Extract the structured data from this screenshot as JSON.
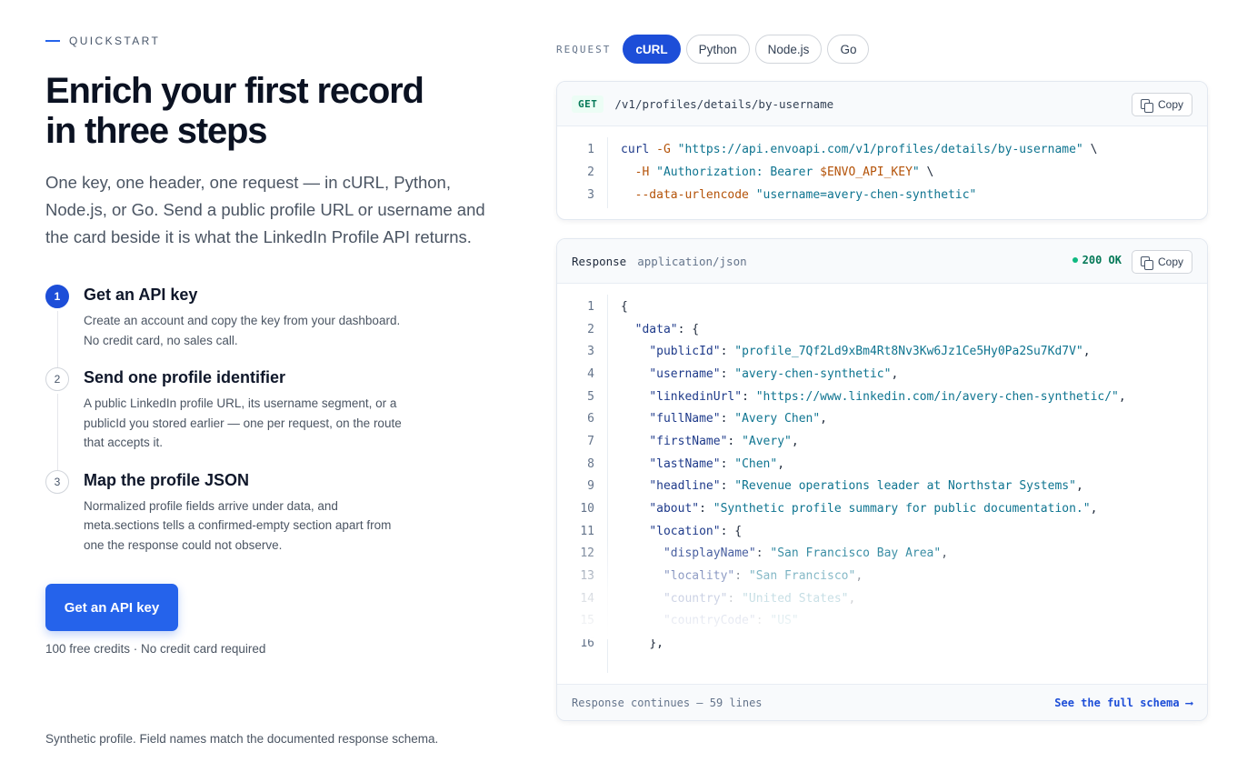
{
  "hero": {
    "eyebrow": "QUICKSTART",
    "title": "Enrich your first record in three steps",
    "lede": "One key, one header, one request — in cURL, Python, Node.js, or Go. Send a public profile URL or username and the card beside it is what the LinkedIn Profile API returns."
  },
  "steps": [
    {
      "number": "1",
      "title": "Get an API key",
      "body": "Create an account and copy the key from your dashboard. No credit card, no sales call."
    },
    {
      "number": "2",
      "title": "Send one profile identifier",
      "body": "A public LinkedIn profile URL, its username segment, or a publicId you stored earlier — one per request, on the route that accepts it."
    },
    {
      "number": "3",
      "title": "Map the profile JSON",
      "body": "Normalized profile fields arrive under data, and meta.sections tells a confirmed-empty section apart from one the response could not observe."
    }
  ],
  "cta": {
    "label": "Get an API key",
    "sub": "100 free credits · No credit card required"
  },
  "footnote": "Synthetic profile. Field names match the documented response schema.",
  "request": {
    "label": "REQUEST",
    "tabs": [
      "cURL",
      "Python",
      "Node.js",
      "Go"
    ],
    "active_tab": 0,
    "method": "GET",
    "path": "/v1/profiles/details/by-username",
    "copy_label": "Copy",
    "line_numbers": [
      "1",
      "2",
      "3"
    ],
    "line1": {
      "cmd": "curl",
      "flag": "-G",
      "url": "\"https://api.envoapi.com/v1/profiles/details/by-username\"",
      "cont": " \\"
    },
    "line2": {
      "flag": "-H",
      "header": "\"Authorization: Bearer ",
      "var": "$ENVO_API_KEY",
      "end": "\"",
      "cont": " \\"
    },
    "line3": {
      "flag": "--data-urlencode",
      "value": "\"username=avery-chen-synthetic\""
    }
  },
  "response": {
    "label": "Response",
    "content_type": "application/json",
    "status": "200 OK",
    "copy_label": "Copy",
    "line_numbers": [
      "1",
      "2",
      "3",
      "4",
      "5",
      "6",
      "7",
      "8",
      "9",
      "10",
      "11",
      "12",
      "13",
      "14",
      "15",
      "16"
    ],
    "lines": [
      {
        "indent": "",
        "key": "",
        "value": "",
        "tail": "{"
      },
      {
        "indent": "  ",
        "key": "\"data\"",
        "value": "",
        "tail": ": {"
      },
      {
        "indent": "    ",
        "key": "\"publicId\"",
        "value": "\"profile_7Qf2Ld9xBm4Rt8Nv3Kw6Jz1Ce5Hy0Pa2Su7Kd7V\"",
        "tail": ","
      },
      {
        "indent": "    ",
        "key": "\"username\"",
        "value": "\"avery-chen-synthetic\"",
        "tail": ","
      },
      {
        "indent": "    ",
        "key": "\"linkedinUrl\"",
        "value": "\"https://www.linkedin.com/in/avery-chen-synthetic/\"",
        "tail": ","
      },
      {
        "indent": "    ",
        "key": "\"fullName\"",
        "value": "\"Avery Chen\"",
        "tail": ","
      },
      {
        "indent": "    ",
        "key": "\"firstName\"",
        "value": "\"Avery\"",
        "tail": ","
      },
      {
        "indent": "    ",
        "key": "\"lastName\"",
        "value": "\"Chen\"",
        "tail": ","
      },
      {
        "indent": "    ",
        "key": "\"headline\"",
        "value": "\"Revenue operations leader at Northstar Systems\"",
        "tail": ","
      },
      {
        "indent": "    ",
        "key": "\"about\"",
        "value": "\"Synthetic profile summary for public documentation.\"",
        "tail": ","
      },
      {
        "indent": "    ",
        "key": "\"location\"",
        "value": "",
        "tail": ": {"
      },
      {
        "indent": "      ",
        "key": "\"displayName\"",
        "value": "\"San Francisco Bay Area\"",
        "tail": ","
      },
      {
        "indent": "      ",
        "key": "\"locality\"",
        "value": "\"San Francisco\"",
        "tail": ","
      },
      {
        "indent": "      ",
        "key": "\"country\"",
        "value": "\"United States\"",
        "tail": ","
      },
      {
        "indent": "      ",
        "key": "\"countryCode\"",
        "value": "\"US\"",
        "tail": ""
      },
      {
        "indent": "    ",
        "key": "",
        "value": "",
        "tail": "},"
      }
    ],
    "more": "Response continues — 59 lines",
    "schema_link": "See the full schema ⟶"
  }
}
